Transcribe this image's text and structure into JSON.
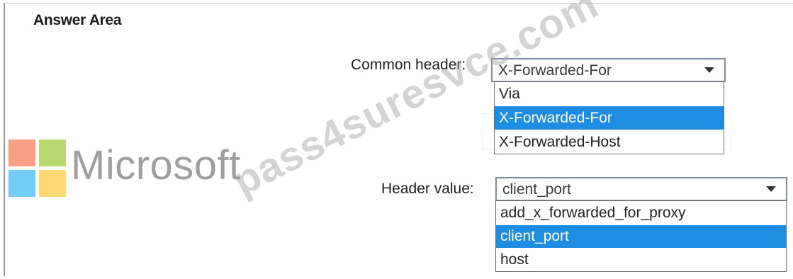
{
  "answer_area": {
    "title": "Answer Area"
  },
  "common_header": {
    "label": "Common header:",
    "selected_value": "X-Forwarded-For",
    "options": [
      "Via",
      "X-Forwarded-For",
      "X-Forwarded-Host"
    ],
    "highlighted_index": 1
  },
  "header_value": {
    "label": "Header value:",
    "selected_value": "client_port",
    "options": [
      "add_x_forwarded_for_proxy",
      "client_port",
      "host"
    ],
    "highlighted_index": 1
  },
  "logo": {
    "wordmark": "Microsoft"
  },
  "watermark": {
    "text": "pass4suresvce.com"
  },
  "colors": {
    "selection": "#1e8ce0",
    "combo_border": "#7f8aa8"
  }
}
